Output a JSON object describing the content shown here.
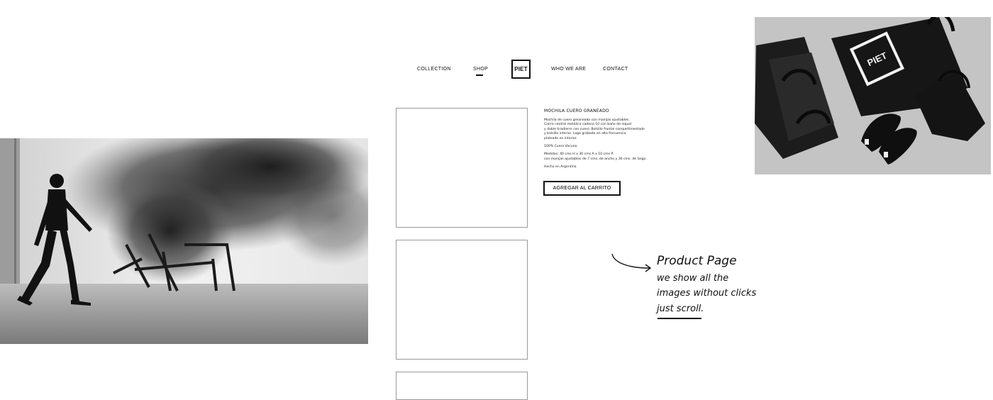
{
  "nav": {
    "collection": "COLLECTION",
    "shop": "SHOP",
    "logo": "PIET",
    "who_we_are": "WHO WE ARE",
    "contact": "CONTACT"
  },
  "product": {
    "title": "MOCHILA CUERO GRANEADO",
    "description": [
      "Mochila de cuero greaneado con manijas ajustables.",
      "Cierre central metálico cadena 10 con baño de níquel",
      "y doble tiradierre con cuero. Bolsillo frontal compartimentado",
      "y bolsillo interior. Logo grabado en alta frecuencia",
      "plateado en interior."
    ],
    "material": "100% Cuero Vacuno.",
    "measures": [
      "Medidas: 40 cms H x 30 cms A x 10 cms P.",
      "con manijas ajustables de 7 cms. de ancho y 30 cms. de largo."
    ],
    "origin": "Hecho en Argentina",
    "add_to_cart": "AGREGAR AL CARRITO"
  },
  "note": {
    "line1": "Product Page",
    "line2": "we show all the",
    "line3": "images without clicks",
    "line4": "just scroll."
  },
  "photo_right": {
    "bag_logo": "PIET"
  }
}
